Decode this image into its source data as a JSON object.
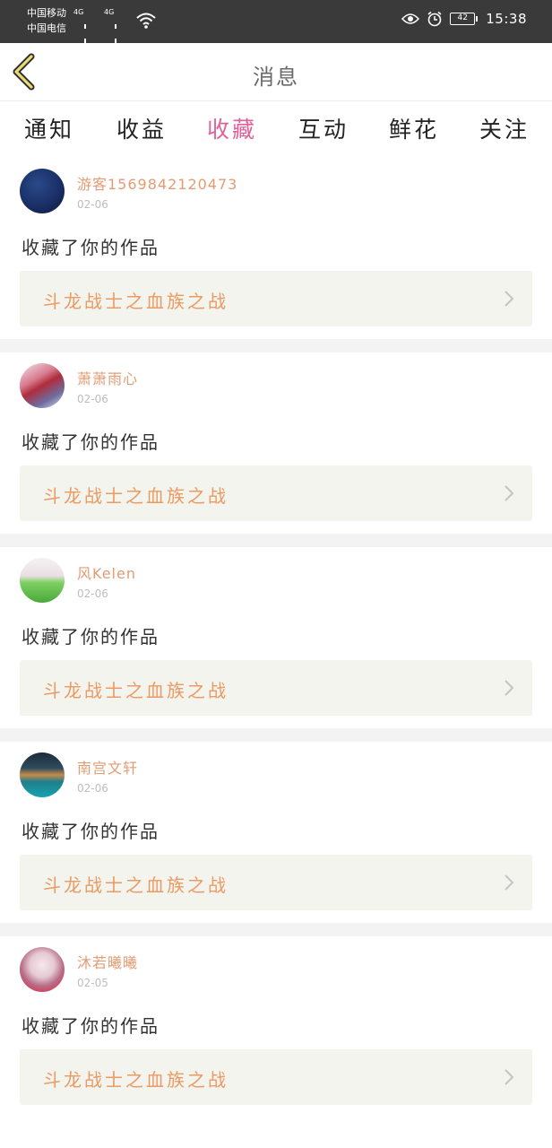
{
  "statusbar": {
    "carrier1": "中国移动",
    "carrier2": "中国电信",
    "network1": "4G",
    "network2": "4G",
    "battery": "42",
    "time": "15:38"
  },
  "header": {
    "title": "消息"
  },
  "tabs": [
    {
      "label": "通知",
      "active": false
    },
    {
      "label": "收益",
      "active": false
    },
    {
      "label": "收藏",
      "active": true
    },
    {
      "label": "互动",
      "active": false
    },
    {
      "label": "鲜花",
      "active": false
    },
    {
      "label": "关注",
      "active": false
    }
  ],
  "colors": {
    "accent": "#e0619a",
    "username": "#e29c74",
    "work_title": "#eb9a62",
    "work_bg": "#f4f4ef"
  },
  "messages": [
    {
      "user": "游客15698421204​73",
      "date": "02-06",
      "text": "收藏了你的作品",
      "work": "斗龙战士之血族之战",
      "avatar": "dark-blue-circle"
    },
    {
      "user": "萧萧雨心",
      "date": "02-06",
      "text": "收藏了你的作品",
      "work": "斗龙战士之血族之战",
      "avatar": "anime-character"
    },
    {
      "user": "风Kelen",
      "date": "02-06",
      "text": "收藏了你的作品",
      "work": "斗龙战士之血族之战",
      "avatar": "green-field"
    },
    {
      "user": "南宫文轩",
      "date": "02-06",
      "text": "收藏了你的作品",
      "work": "斗龙战士之血族之战",
      "avatar": "night-city"
    },
    {
      "user": "沐若曦曦",
      "date": "02-05",
      "text": "收藏了你的作品",
      "work": "斗龙战士之血族之战",
      "avatar": "girl-portrait"
    }
  ]
}
